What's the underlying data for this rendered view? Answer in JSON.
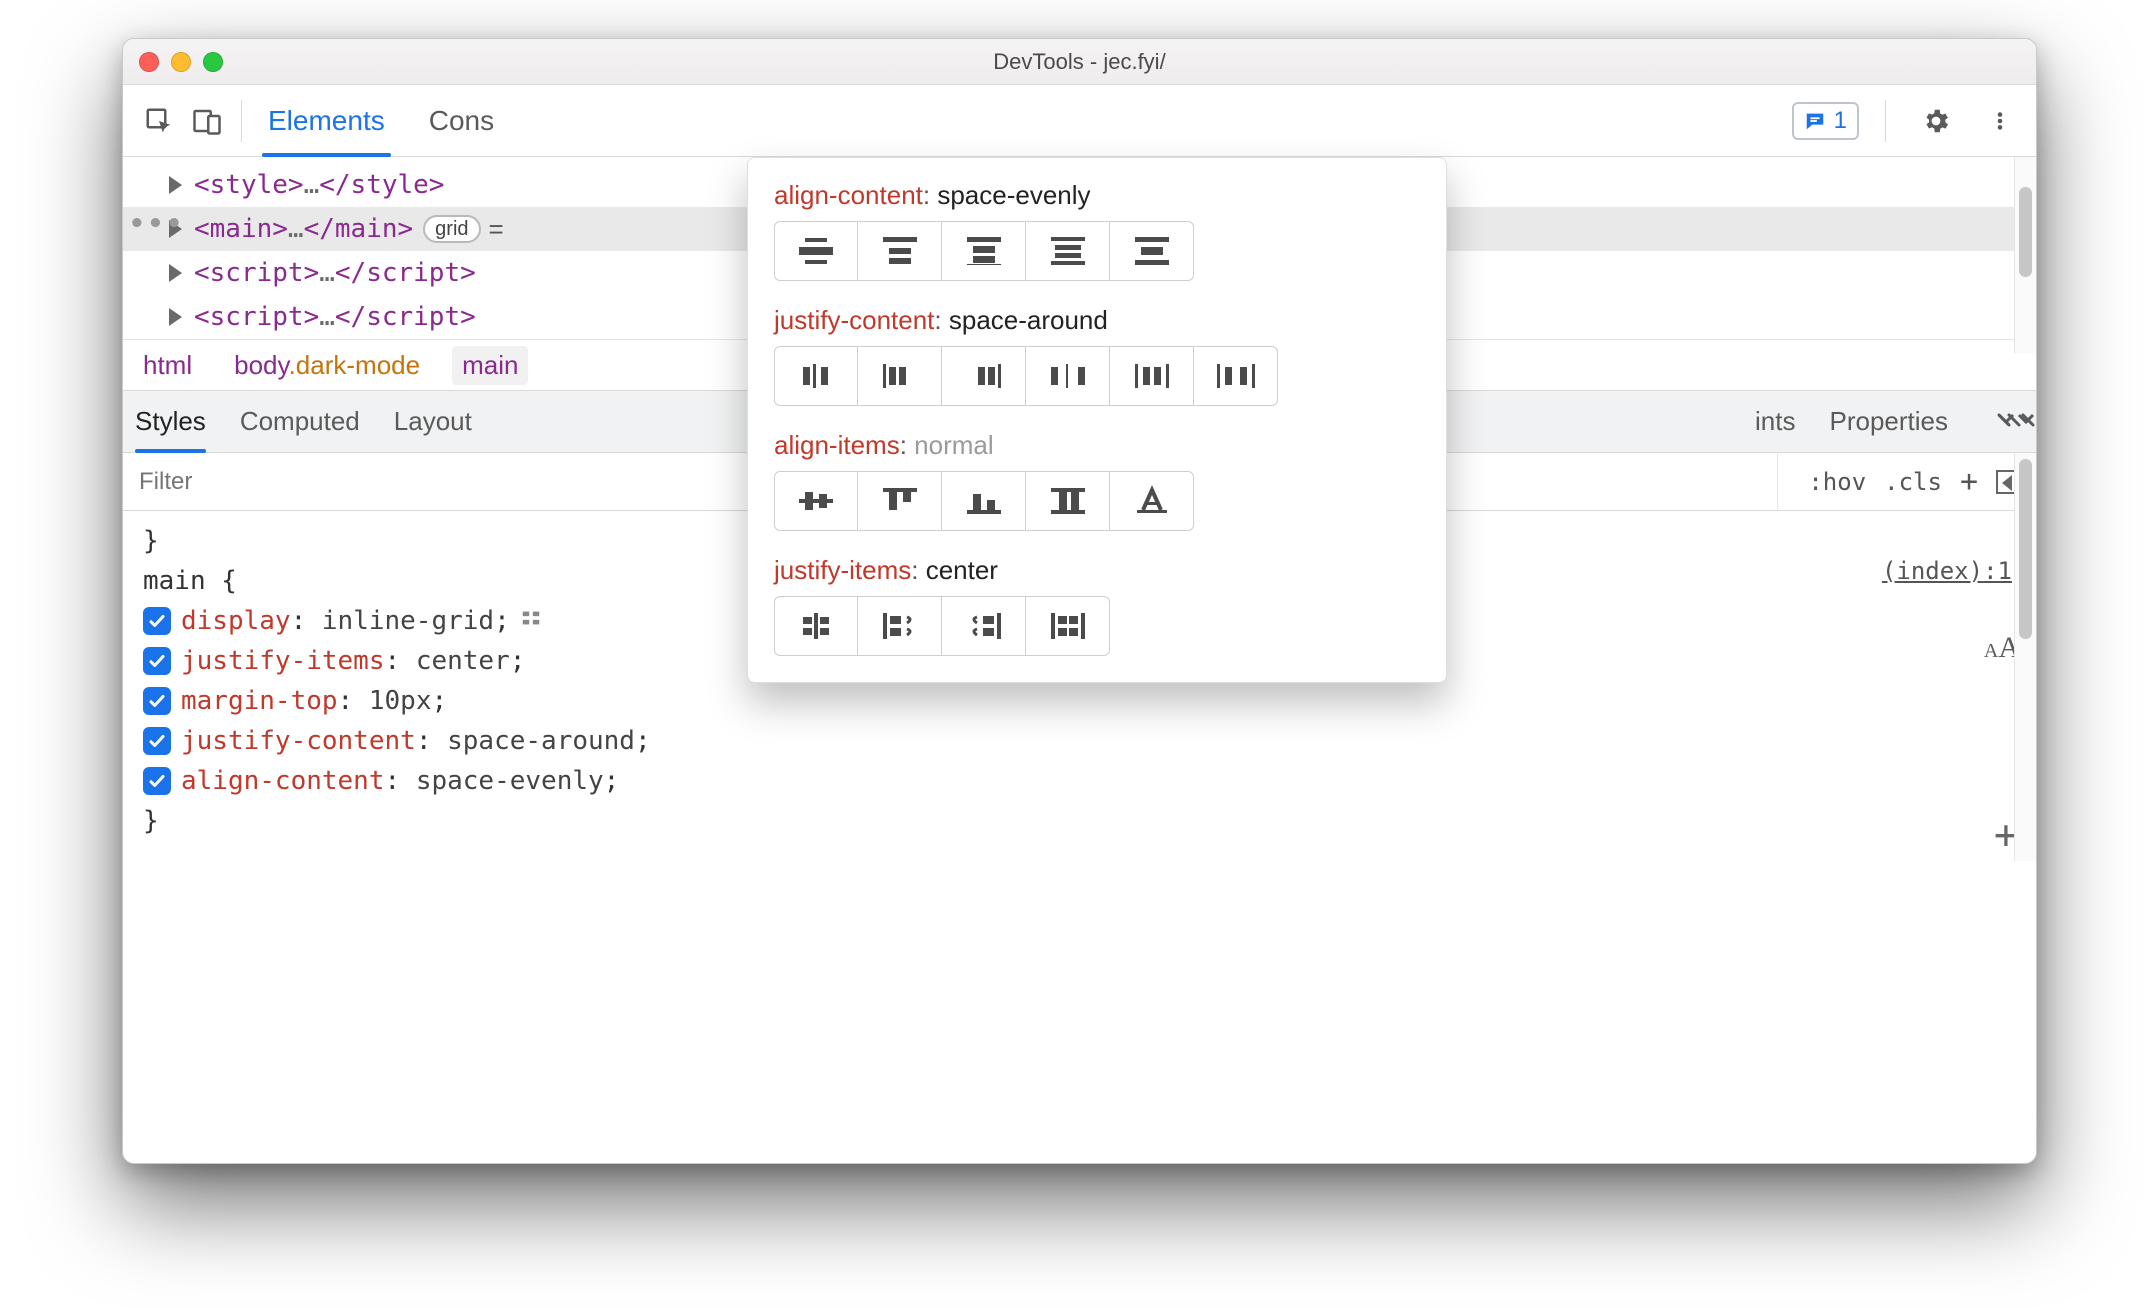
{
  "window": {
    "title": "DevTools - jec.fyi/"
  },
  "toolbar": {
    "tabs": {
      "elements": "Elements",
      "console_partial": "Cons"
    },
    "messages_count": "1"
  },
  "dom": {
    "overflow": "•••",
    "rows": [
      {
        "open": "<style>",
        "mid": "…",
        "close": "</style>"
      },
      {
        "open": "<main>",
        "mid": "…",
        "close": "</main>",
        "badge": "grid",
        "eq": "="
      },
      {
        "open": "<script>",
        "mid": "…",
        "close": "</script>"
      },
      {
        "open": "<script>",
        "mid": "…",
        "close": "</script>"
      }
    ]
  },
  "breadcrumb": {
    "items": [
      {
        "text": "html"
      },
      {
        "text": "body",
        "cls": ".dark-mode"
      },
      {
        "text": "main"
      }
    ]
  },
  "drawer": {
    "tabs": {
      "styles": "Styles",
      "computed": "Computed",
      "layout": "Layout",
      "breakpoints_partial": "ints",
      "properties": "Properties"
    }
  },
  "filter": {
    "placeholder": "Filter",
    "hov": ":hov",
    "cls": ".cls"
  },
  "styles": {
    "closing": "}",
    "selector_open": "main {",
    "source": {
      "label": "(index)",
      "line": ":1"
    },
    "decls": [
      {
        "prop": "display",
        "value": "inline-grid",
        "trail": ";"
      },
      {
        "prop": "justify-items",
        "value": "center",
        "trail": ";"
      },
      {
        "prop": "margin-top",
        "value": "10px",
        "trail": ";"
      },
      {
        "prop": "justify-content",
        "value": "space-around",
        "trail": ";"
      },
      {
        "prop": "align-content",
        "value": "space-evenly",
        "trail": ";"
      }
    ],
    "close": "}"
  },
  "popover": {
    "sections": [
      {
        "prop": "align-content",
        "value": "space-evenly",
        "dim": false,
        "options": 5,
        "active": 3
      },
      {
        "prop": "justify-content",
        "value": "space-around",
        "dim": false,
        "options": 6,
        "active": 4
      },
      {
        "prop": "align-items",
        "value": "normal",
        "dim": true,
        "options": 5,
        "active": -1
      },
      {
        "prop": "justify-items",
        "value": "center",
        "dim": false,
        "options": 4,
        "active": 0
      }
    ]
  }
}
